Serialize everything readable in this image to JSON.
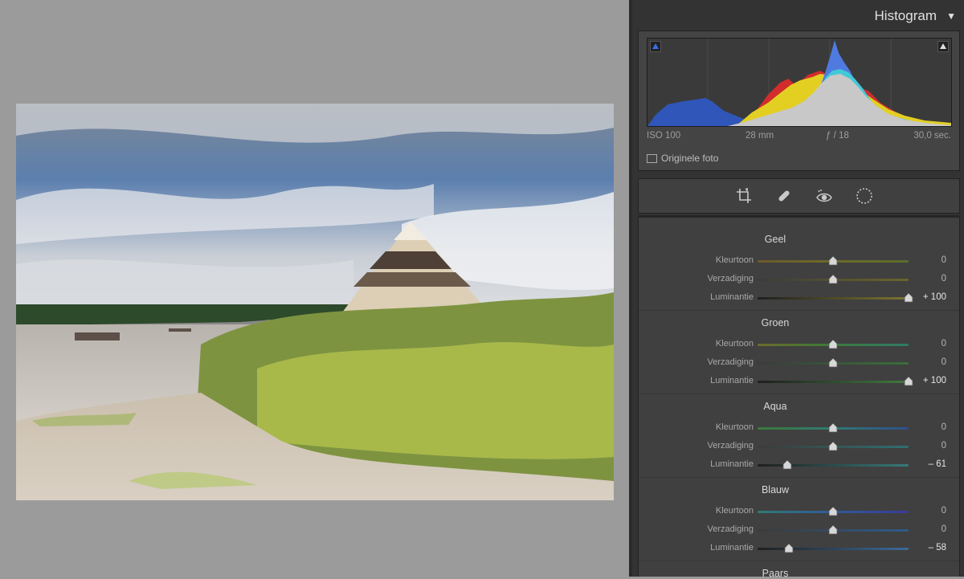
{
  "histogram": {
    "title": "Histogram",
    "toggle": "▼",
    "exif": {
      "iso": "ISO 100",
      "focal": "28 mm",
      "aperture": "ƒ / 18",
      "shutter": "30,0 sec."
    },
    "original_photo_label": "Originele foto"
  },
  "tools": [
    "crop-icon",
    "healing-icon",
    "red-eye-icon",
    "mask-icon"
  ],
  "hsl": {
    "groups": [
      {
        "title": "Geel",
        "rows": [
          {
            "label": "Kleurtoon",
            "value": "0",
            "pos": 0.5
          },
          {
            "label": "Verzadiging",
            "value": "0",
            "pos": 0.5
          },
          {
            "label": "Luminantie",
            "value": "+ 100",
            "pos": 1.0
          }
        ]
      },
      {
        "title": "Groen",
        "rows": [
          {
            "label": "Kleurtoon",
            "value": "0",
            "pos": 0.5
          },
          {
            "label": "Verzadiging",
            "value": "0",
            "pos": 0.5
          },
          {
            "label": "Luminantie",
            "value": "+ 100",
            "pos": 1.0
          }
        ]
      },
      {
        "title": "Aqua",
        "rows": [
          {
            "label": "Kleurtoon",
            "value": "0",
            "pos": 0.5
          },
          {
            "label": "Verzadiging",
            "value": "0",
            "pos": 0.5
          },
          {
            "label": "Luminantie",
            "value": "– 61",
            "pos": 0.195
          }
        ]
      },
      {
        "title": "Blauw",
        "rows": [
          {
            "label": "Kleurtoon",
            "value": "0",
            "pos": 0.5
          },
          {
            "label": "Verzadiging",
            "value": "0",
            "pos": 0.5
          },
          {
            "label": "Luminantie",
            "value": "– 58",
            "pos": 0.21
          }
        ]
      },
      {
        "title": "Paars",
        "rows": []
      }
    ]
  },
  "colors": {
    "panel_bg": "#404040",
    "canvas_bg": "#9b9b9b",
    "accent": "#e6e6e6"
  }
}
